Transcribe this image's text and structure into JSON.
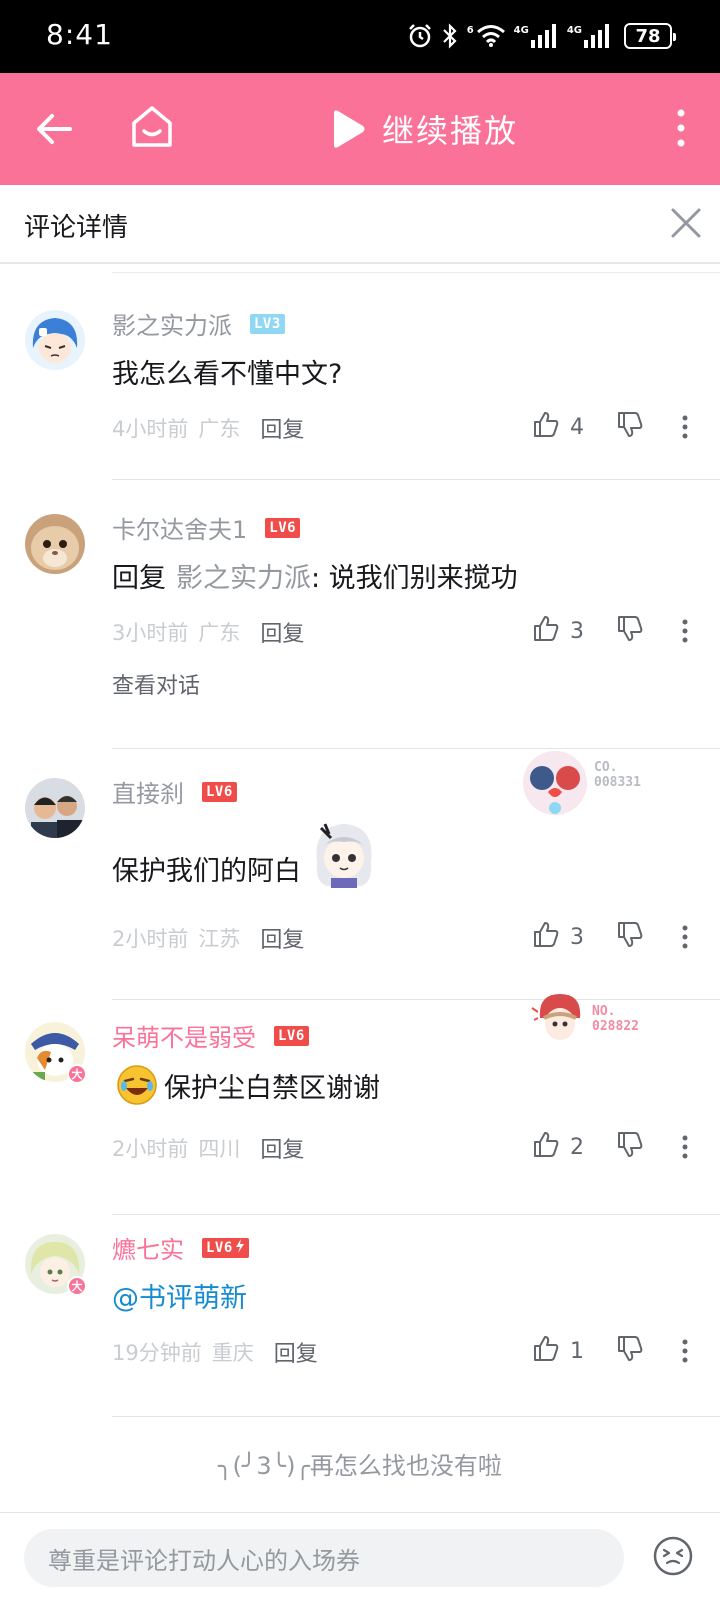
{
  "status_bar": {
    "time": "8:41",
    "network_tag_1": "4G",
    "network_tag_2": "4G",
    "wifi_tag": "6",
    "battery": "78",
    "icons": [
      "alarm-icon",
      "bluetooth-icon",
      "wifi-icon",
      "signal-icon",
      "signal-icon",
      "battery-icon"
    ]
  },
  "top_bar": {
    "continue_label": "继续播放",
    "icons": [
      "back-arrow-icon",
      "home-icon",
      "play-icon",
      "more-vertical-icon"
    ],
    "background": "#fb7299"
  },
  "detail_header": {
    "title": "评论详情",
    "close_icon": "close-icon"
  },
  "comments": [
    {
      "username": "影之实力派",
      "level": "LV3",
      "content": "我怎么看不懂中文?",
      "time": "4小时前",
      "location": "广东",
      "reply_label": "回复",
      "likes": "4"
    },
    {
      "username": "卡尔达舍夫1",
      "level": "LV6",
      "reply_prefix": "回复",
      "reply_target": "影之实力派",
      "content": ": 说我们别来搅功",
      "time": "3小时前",
      "location": "广东",
      "reply_label": "回复",
      "likes": "3",
      "view_conversation": "查看对话"
    },
    {
      "username": "直接刹",
      "level": "LV6",
      "badge_label": "CO.",
      "badge_number": "008331",
      "content": "保护我们的阿白",
      "time": "2小时前",
      "location": "江苏",
      "reply_label": "回复",
      "likes": "3"
    },
    {
      "username": "呆萌不是弱受",
      "level": "LV6",
      "badge_label": "NO.",
      "badge_number": "028822",
      "vip_mark": "大",
      "content": "保护尘白禁区谢谢",
      "time": "2小时前",
      "location": "四川",
      "reply_label": "回复",
      "likes": "2"
    },
    {
      "username": "爊七实",
      "level": "LV6",
      "vip_mark": "大",
      "content": "@书评萌新",
      "time": "19分钟前",
      "location": "重庆",
      "reply_label": "回复",
      "likes": "1"
    }
  ],
  "end_text": "╮(╯3╰)╭再怎么找也没有啦",
  "input": {
    "placeholder": "尊重是评论打动人心的入场券",
    "emoji_icon": "emoji-icon"
  },
  "colors": {
    "accent": "#fb7299",
    "level3": "#8fd7f2",
    "level6": "#f04c49",
    "link": "#178bcf"
  }
}
